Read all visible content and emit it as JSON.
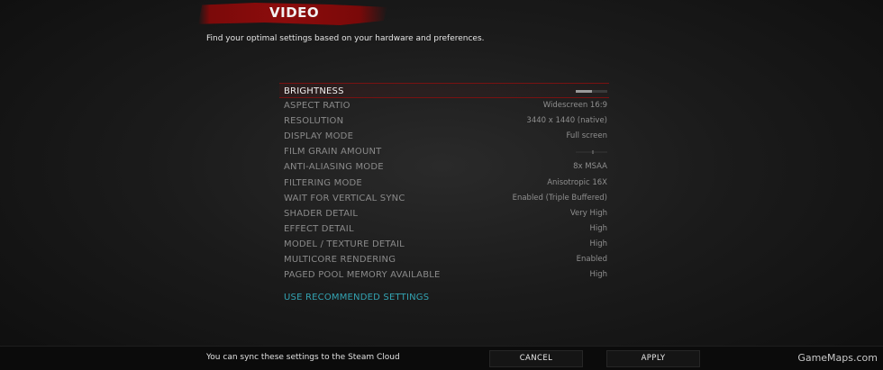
{
  "header": {
    "title": "VIDEO",
    "subtitle": "Find your optimal settings based on your hardware and preferences."
  },
  "settings": [
    {
      "label": "BRIGHTNESS",
      "control": "slider",
      "level_percent": 50,
      "selected": true
    },
    {
      "label": "ASPECT RATIO",
      "value": "Widescreen 16:9"
    },
    {
      "label": "RESOLUTION",
      "value": "3440 x 1440 (native)"
    },
    {
      "label": "DISPLAY MODE",
      "value": "Full screen"
    },
    {
      "label": "FILM GRAIN AMOUNT",
      "control": "slider",
      "level_percent": 50,
      "disabled": true
    },
    {
      "label": "ANTI-ALIASING MODE",
      "value": "8x MSAA"
    },
    {
      "label": "FILTERING MODE",
      "value": "Anisotropic 16X"
    },
    {
      "label": "WAIT FOR VERTICAL SYNC",
      "value": "Enabled (Triple Buffered)"
    },
    {
      "label": "SHADER DETAIL",
      "value": "Very High"
    },
    {
      "label": "EFFECT DETAIL",
      "value": "High"
    },
    {
      "label": "MODEL / TEXTURE DETAIL",
      "value": "High"
    },
    {
      "label": "MULTICORE RENDERING",
      "value": "Enabled"
    },
    {
      "label": "PAGED POOL MEMORY AVAILABLE",
      "value": "High"
    }
  ],
  "recommended_label": "USE RECOMMENDED SETTINGS",
  "footer": {
    "sync_text": "You can sync these settings to the Steam Cloud",
    "cancel_label": "CANCEL",
    "apply_label": "APPLY"
  },
  "watermark": "GameMaps.com",
  "colors": {
    "accent_red": "#8c0c0c",
    "link_teal": "#33a3b2"
  }
}
